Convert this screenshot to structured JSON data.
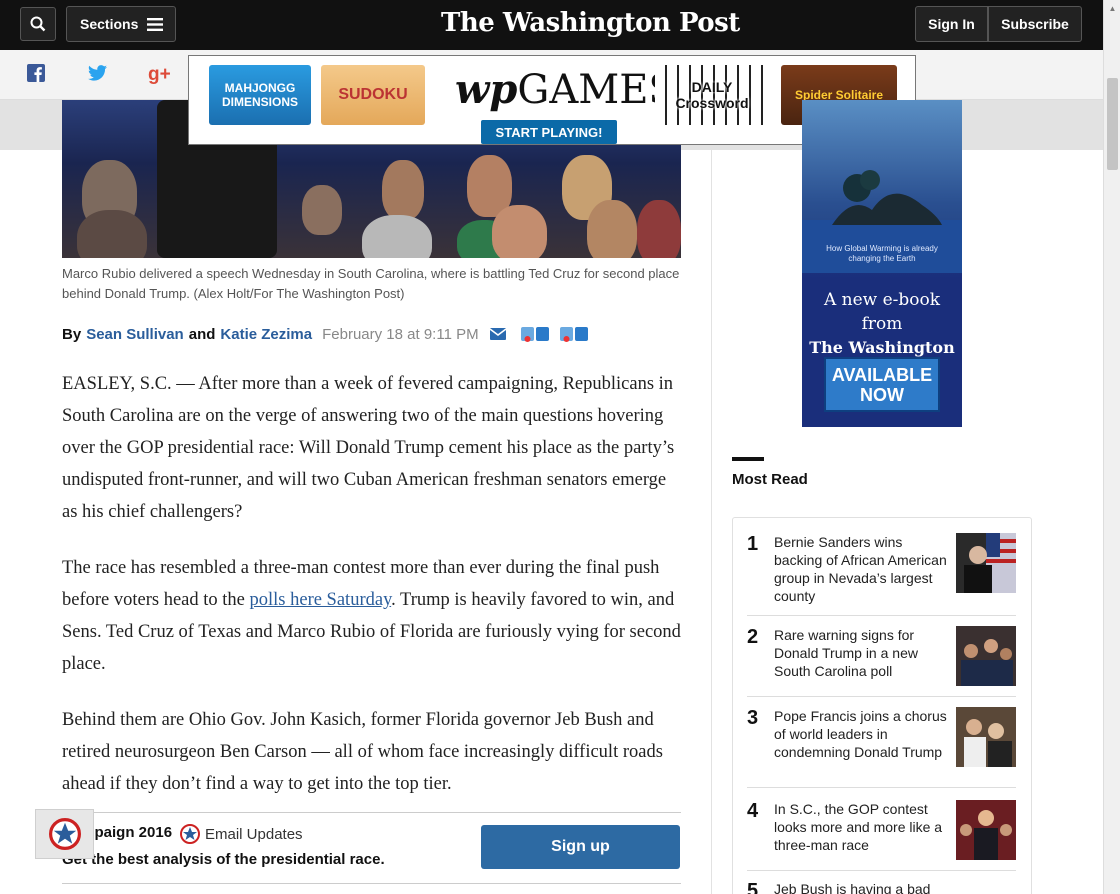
{
  "header": {
    "sections_label": "Sections",
    "logo_text": "The Washington Post",
    "signin_label": "Sign In",
    "subscribe_label": "Subscribe"
  },
  "share": {
    "facebook": "f",
    "twitter": "t",
    "googleplus": "g+"
  },
  "games_ad": {
    "tile1": "MAHJONGG DIMENSIONS",
    "tile2": "SUDOKU",
    "brand_wp": "wp",
    "brand_games": "GAMES",
    "cta": "START PLAYING!",
    "tile3": "DAILY Crossword",
    "tile4": "Spider Solitaire"
  },
  "article": {
    "caption": "Marco Rubio delivered a speech Wednesday in South Carolina, where is battling Ted Cruz for second place behind Donald Trump. (Alex Holt/For The Washington Post)",
    "byline_by": "By",
    "author1": "Sean Sullivan",
    "byline_and": "and",
    "author2": "Katie Zezima",
    "date": "February 18 at 9:11 PM",
    "p1": "EASLEY, S.C. — After more than a week of fevered campaigning, Republicans in South Carolina are on the verge of answering two of the main questions hovering over the GOP presidential race: Will Donald Trump cement his place as the party’s undisputed front-runner, and will two Cuban American freshman senators emerge as his chief challengers?",
    "p2_before": "The race has resembled a three-man contest more than ever during the final push before voters head to the ",
    "p2_link": "polls here Saturday",
    "p2_after": ". Trump is heavily favored to win, and Sens. Ted Cruz of Texas and Marco Rubio of Florida are furiously vying for second place.",
    "p3": "Behind them are Ohio Gov. John Kasich, former Florida governor Jeb Bush and retired neurosurgeon Ben Carson — all of whom face increasingly difficult roads ahead if they don’t find a way to get into the top tier."
  },
  "newsletter": {
    "title": "Campaign 2016",
    "updates": "Email Updates",
    "subtitle": "Get the best analysis of the presidential race.",
    "button": "Sign up"
  },
  "ebook_ad": {
    "small_text": "How Global Warming is already changing the Earth",
    "line1": "A new e-book from",
    "line2": "The Washington Post",
    "button": "AVAILABLE NOW"
  },
  "most_read": {
    "title": "Most Read",
    "items": [
      {
        "num": "1",
        "text": "Bernie Sanders wins backing of African American group in Nevada’s largest county"
      },
      {
        "num": "2",
        "text": "Rare warning signs for Donald Trump in a new South Carolina poll"
      },
      {
        "num": "3",
        "text": "Pope Francis joins a chorus of world leaders in condemning Donald Trump"
      },
      {
        "num": "4",
        "text": "In S.C., the GOP contest looks more and more like a three-man race"
      },
      {
        "num": "5",
        "text": "Jeb Bush is having a bad"
      }
    ]
  }
}
